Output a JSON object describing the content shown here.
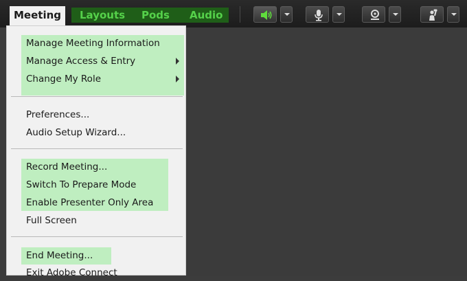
{
  "menubar": {
    "items": [
      {
        "label": "Meeting"
      },
      {
        "label": "Layouts"
      },
      {
        "label": "Pods"
      },
      {
        "label": "Audio"
      }
    ],
    "colors": {
      "green_text": "#55d14a",
      "active_bg": "#f1f1f1"
    }
  },
  "toolbar": {
    "icons": [
      "speaker-icon",
      "microphone-icon",
      "webcam-icon",
      "raise-hand-icon"
    ]
  },
  "meeting_menu": {
    "items": [
      {
        "label": "Manage Meeting Information"
      },
      {
        "label": "Manage Access & Entry"
      },
      {
        "label": "Change My Role"
      },
      {
        "label": "Preferences..."
      },
      {
        "label": "Audio Setup Wizard..."
      },
      {
        "label": "Record Meeting..."
      },
      {
        "label": "Switch To Prepare Mode"
      },
      {
        "label": "Enable Presenter Only Area"
      },
      {
        "label": "Full Screen"
      },
      {
        "label": "End Meeting..."
      },
      {
        "label": "Exit Adobe Connect"
      }
    ],
    "highlight_color": "#bfeec0"
  }
}
